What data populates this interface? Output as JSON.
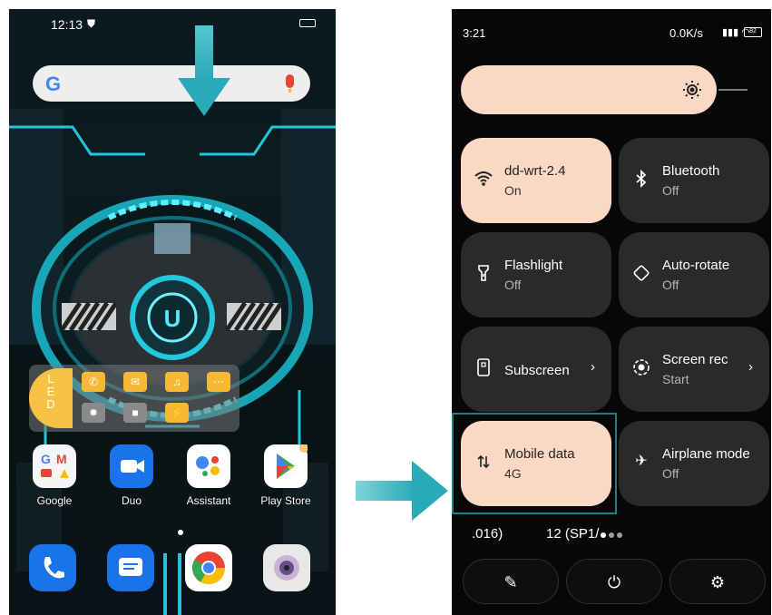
{
  "left_phone": {
    "status": {
      "time": "12:13",
      "shield_icon": "shield-icon"
    },
    "search": {
      "logo": "G",
      "mic_icon": "mic-icon"
    },
    "led_widget": {
      "tab_letters": [
        "L",
        "E",
        "D"
      ],
      "icons": [
        "phone-icon",
        "message-icon",
        "music-icon",
        "more-icon",
        "bulb-icon",
        "camera-icon",
        "bolt-icon"
      ]
    },
    "apps": [
      {
        "label": "Google"
      },
      {
        "label": "Duo"
      },
      {
        "label": "Assistant"
      },
      {
        "label": "Play Store"
      }
    ],
    "dock": [
      "phone-icon",
      "messages-icon",
      "chrome-icon",
      "camera-icon"
    ]
  },
  "right_phone": {
    "status": {
      "time": "3:21",
      "speed": "0.0K/s",
      "battery": "82"
    },
    "tiles": [
      {
        "title": "dd-wrt-2.4",
        "subtitle": "On",
        "icon": "wifi-icon",
        "active": true
      },
      {
        "title": "Bluetooth",
        "subtitle": "Off",
        "icon": "bluetooth-icon",
        "active": false
      },
      {
        "title": "Flashlight",
        "subtitle": "Off",
        "icon": "flashlight-icon",
        "active": false
      },
      {
        "title": "Auto-rotate",
        "subtitle": "Off",
        "icon": "rotate-icon",
        "active": false
      },
      {
        "title": "Subscreen",
        "subtitle": "",
        "icon": "subscreen-icon",
        "active": false
      },
      {
        "title": "Screen rec",
        "subtitle": "Start",
        "icon": "record-icon",
        "active": false
      },
      {
        "title": "Mobile data",
        "subtitle": "4G",
        "icon": "data-icon",
        "active": true
      },
      {
        "title": "Airplane mode",
        "subtitle": "Off",
        "icon": "airplane-icon",
        "active": false
      }
    ],
    "footer": {
      "build_left": ".016)",
      "build_right": "12 (SP1/"
    },
    "buttons": [
      "edit-icon",
      "power-icon",
      "settings-icon"
    ]
  }
}
